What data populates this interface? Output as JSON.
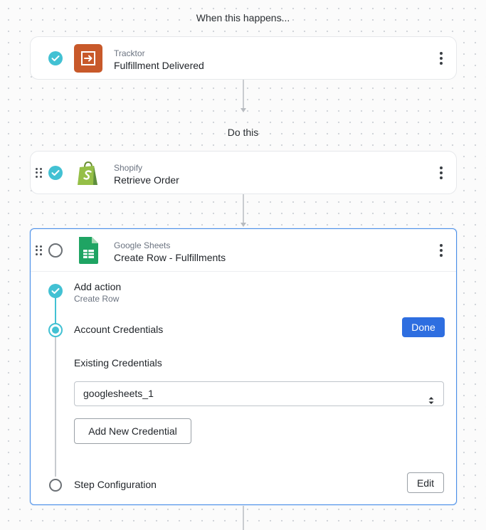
{
  "trigger_label": "When this happens...",
  "action_label": "Do this",
  "trigger_step": {
    "app": "Tracktor",
    "name": "Fulfillment Delivered",
    "icon": "tracktor-logo-icon",
    "color": "#c8592a"
  },
  "steps": [
    {
      "app": "Shopify",
      "name": "Retrieve Order",
      "icon": "shopify-bag-icon",
      "color": "#95bf47"
    },
    {
      "app": "Google Sheets",
      "name": "Create Row - Fulfillments",
      "icon": "google-sheets-icon",
      "color": "#1fa463",
      "substeps": {
        "add_action": {
          "title": "Add action",
          "subtitle": "Create Row"
        },
        "credentials": {
          "title": "Account Credentials",
          "done_label": "Done",
          "existing_label": "Existing Credentials",
          "selected": "googlesheets_1",
          "add_label": "Add New Credential"
        },
        "config": {
          "title": "Step Configuration",
          "edit_label": "Edit"
        }
      }
    }
  ],
  "colors": {
    "accent": "#42c1d3",
    "primary_button": "#2e6ee0",
    "active_border": "#4a8fe8"
  }
}
